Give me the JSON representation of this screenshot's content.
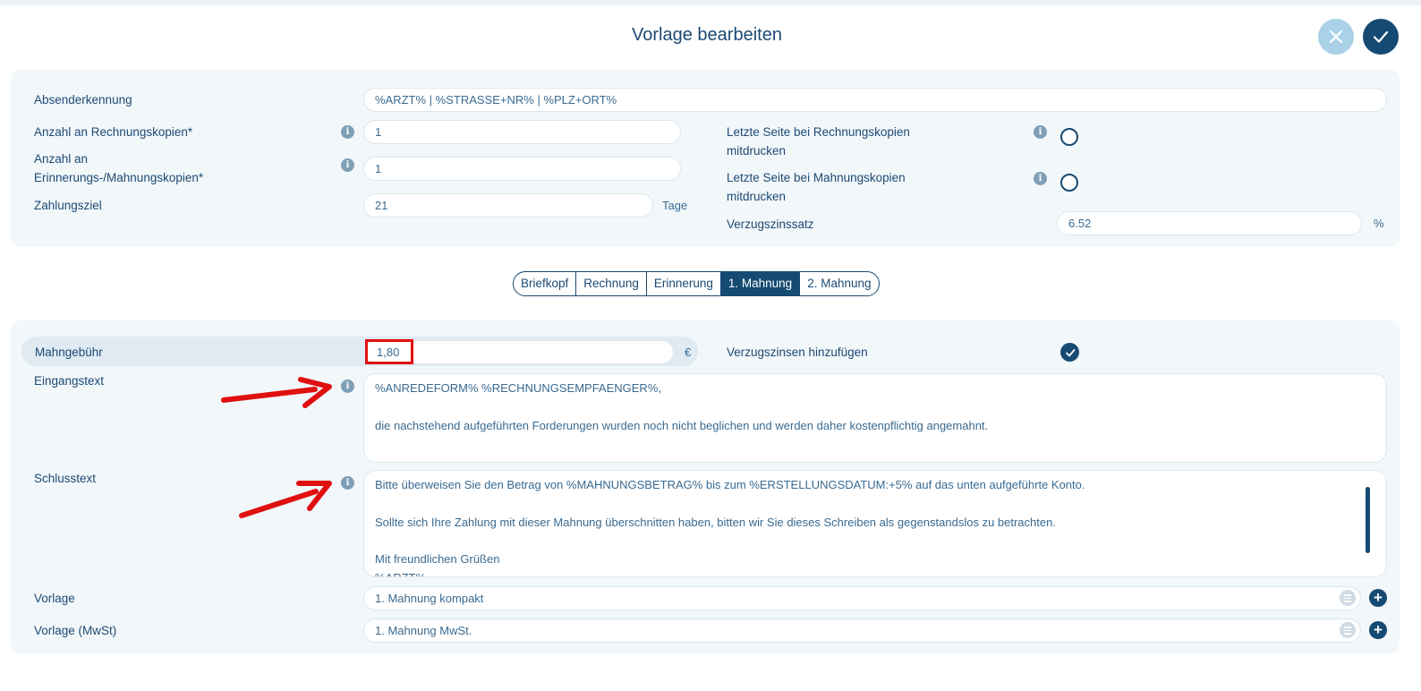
{
  "dialog": {
    "title": "Vorlage bearbeiten",
    "cancel_icon": "close-icon",
    "confirm_icon": "check-icon"
  },
  "general": {
    "sender_label": "Absenderkennung",
    "sender_value": "%ARZT% | %STRASSE+NR% | %PLZ+ORT%",
    "invoice_copies_label": "Anzahl an Rechnungskopien*",
    "invoice_copies_value": "1",
    "reminder_copies_label_line1": "Anzahl an",
    "reminder_copies_label_line2": "Erinnerungs-/Mahnungskopien*",
    "reminder_copies_value": "1",
    "payment_term_label": "Zahlungsziel",
    "payment_term_value": "21",
    "payment_term_unit": "Tage",
    "last_page_invoice_label_line1": "Letzte Seite bei Rechnungskopien",
    "last_page_invoice_label_line2": "mitdrucken",
    "last_page_reminder_label_line1": "Letzte Seite bei Mahnungskopien",
    "last_page_reminder_label_line2": "mitdrucken",
    "interest_rate_label": "Verzugszinssatz",
    "interest_rate_value": "6.52",
    "interest_rate_unit": "%"
  },
  "tabs": [
    {
      "label": "Briefkopf",
      "active": false
    },
    {
      "label": "Rechnung",
      "active": false
    },
    {
      "label": "Erinnerung",
      "active": false
    },
    {
      "label": "1. Mahnung",
      "active": true
    },
    {
      "label": "2. Mahnung",
      "active": false
    }
  ],
  "reminder": {
    "fee_label": "Mahngebühr",
    "fee_value": "1,80",
    "fee_unit": "€",
    "add_interest_label": "Verzugszinsen hinzufügen",
    "add_interest_checked": true,
    "intro_label": "Eingangstext",
    "intro_lines": [
      "%ANREDEFORM% %RECHNUNGSEMPFAENGER%,",
      "",
      "die nachstehend aufgeführten Forderungen wurden noch nicht beglichen und werden daher kostenpflichtig angemahnt."
    ],
    "closing_label": "Schlusstext",
    "closing_lines": [
      "Bitte überweisen Sie den Betrag von %MAHNUNGSBETRAG% bis zum %ERSTELLUNGSDATUM:+5% auf das unten aufgeführte Konto.",
      "",
      "Sollte sich Ihre Zahlung mit dieser Mahnung überschnitten haben, bitten wir Sie dieses Schreiben als gegenstandslos zu betrachten.",
      "",
      "Mit freundlichen Grüßen",
      "%ARZT%"
    ],
    "template_label": "Vorlage",
    "template_value": "1. Mahnung kompakt",
    "template_vat_label": "Vorlage (MwSt)",
    "template_vat_value": "1. Mahnung MwSt."
  },
  "colors": {
    "primary": "#154a72",
    "accent_light": "#a9d2e8",
    "panel_bg": "#f2f7fa",
    "annotation_red": "#e01010"
  }
}
